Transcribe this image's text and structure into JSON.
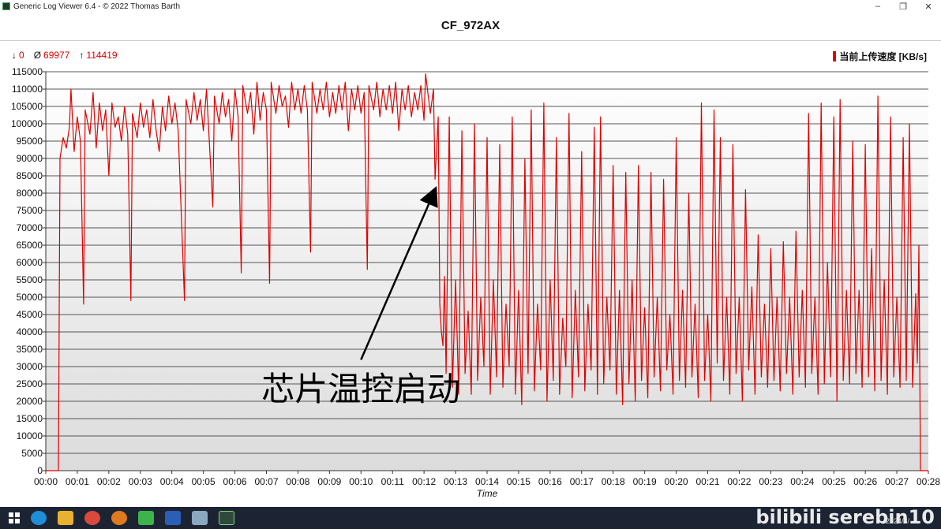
{
  "window": {
    "title": "Generic Log Viewer 6.4 - © 2022 Thomas Barth",
    "minimize_glyph": "–",
    "maximize_glyph": "❐",
    "close_glyph": "✕"
  },
  "stats": {
    "min_symbol": "↓",
    "min": "0",
    "avg_symbol": "Ø",
    "avg": "69977",
    "max_symbol": "↑",
    "max": "114419"
  },
  "taskbar": {
    "icons": [
      "windows-start-icon",
      "edge-icon",
      "file-explorer-icon",
      "chrome-icon",
      "search-app-icon",
      "wechat-icon",
      "word-icon",
      "app-icon",
      "terminal-icon"
    ],
    "watermark": "bilibili serebin10",
    "date": "2024/8/"
  },
  "chart_data": {
    "type": "line",
    "title": "CF_972AX",
    "xlabel": "Time",
    "ylabel": "",
    "ylim": [
      0,
      115000
    ],
    "yticks": [
      0,
      5000,
      10000,
      15000,
      20000,
      25000,
      30000,
      35000,
      40000,
      45000,
      50000,
      55000,
      60000,
      65000,
      70000,
      75000,
      80000,
      85000,
      90000,
      95000,
      100000,
      105000,
      110000,
      115000
    ],
    "xlim": [
      0,
      28
    ],
    "xticks": [
      "00:00",
      "00:01",
      "00:02",
      "00:03",
      "00:04",
      "00:05",
      "00:06",
      "00:07",
      "00:08",
      "00:09",
      "00:10",
      "00:11",
      "00:12",
      "00:13",
      "00:14",
      "00:15",
      "00:16",
      "00:17",
      "00:18",
      "00:19",
      "00:20",
      "00:21",
      "00:22",
      "00:23",
      "00:24",
      "00:25",
      "00:26",
      "00:27",
      "00:28"
    ],
    "grid": true,
    "legend_position": "top-right",
    "series": [
      {
        "name": "当前上传速度 [KB/s]",
        "color": "#e00000",
        "points": [
          [
            0,
            0
          ],
          [
            0.4,
            0
          ],
          [
            0.45,
            90000
          ],
          [
            0.55,
            96000
          ],
          [
            0.65,
            93000
          ],
          [
            0.75,
            99000
          ],
          [
            0.8,
            110000
          ],
          [
            0.9,
            92000
          ],
          [
            1.0,
            102000
          ],
          [
            1.1,
            95000
          ],
          [
            1.2,
            48000
          ],
          [
            1.25,
            104000
          ],
          [
            1.4,
            97000
          ],
          [
            1.5,
            109000
          ],
          [
            1.6,
            93000
          ],
          [
            1.7,
            106000
          ],
          [
            1.8,
            98000
          ],
          [
            1.9,
            104000
          ],
          [
            2.0,
            85000
          ],
          [
            2.1,
            106000
          ],
          [
            2.2,
            99000
          ],
          [
            2.3,
            102000
          ],
          [
            2.4,
            95000
          ],
          [
            2.5,
            105000
          ],
          [
            2.6,
            97000
          ],
          [
            2.7,
            49000
          ],
          [
            2.75,
            103000
          ],
          [
            2.9,
            96000
          ],
          [
            3.0,
            106000
          ],
          [
            3.1,
            99000
          ],
          [
            3.2,
            104000
          ],
          [
            3.3,
            96000
          ],
          [
            3.4,
            107000
          ],
          [
            3.5,
            98000
          ],
          [
            3.6,
            92000
          ],
          [
            3.7,
            105000
          ],
          [
            3.8,
            98000
          ],
          [
            3.9,
            108000
          ],
          [
            4.0,
            100000
          ],
          [
            4.1,
            106000
          ],
          [
            4.2,
            98000
          ],
          [
            4.4,
            49000
          ],
          [
            4.45,
            107000
          ],
          [
            4.6,
            100000
          ],
          [
            4.7,
            109000
          ],
          [
            4.8,
            101000
          ],
          [
            4.9,
            107000
          ],
          [
            5.0,
            98000
          ],
          [
            5.1,
            110000
          ],
          [
            5.3,
            76000
          ],
          [
            5.35,
            108000
          ],
          [
            5.5,
            100000
          ],
          [
            5.6,
            109000
          ],
          [
            5.7,
            102000
          ],
          [
            5.8,
            107000
          ],
          [
            5.9,
            95000
          ],
          [
            6.0,
            110000
          ],
          [
            6.1,
            102000
          ],
          [
            6.2,
            57000
          ],
          [
            6.25,
            111000
          ],
          [
            6.4,
            103000
          ],
          [
            6.5,
            109000
          ],
          [
            6.6,
            97000
          ],
          [
            6.7,
            112000
          ],
          [
            6.8,
            101000
          ],
          [
            6.9,
            109000
          ],
          [
            7.0,
            104000
          ],
          [
            7.1,
            54000
          ],
          [
            7.15,
            112000
          ],
          [
            7.3,
            103000
          ],
          [
            7.4,
            111000
          ],
          [
            7.5,
            105000
          ],
          [
            7.6,
            108000
          ],
          [
            7.7,
            99000
          ],
          [
            7.8,
            112000
          ],
          [
            7.9,
            104000
          ],
          [
            8.0,
            110000
          ],
          [
            8.1,
            103000
          ],
          [
            8.2,
            111000
          ],
          [
            8.3,
            104000
          ],
          [
            8.4,
            63000
          ],
          [
            8.45,
            112000
          ],
          [
            8.6,
            103000
          ],
          [
            8.7,
            110000
          ],
          [
            8.8,
            104000
          ],
          [
            8.9,
            112000
          ],
          [
            9.0,
            102000
          ],
          [
            9.1,
            109000
          ],
          [
            9.2,
            103000
          ],
          [
            9.3,
            111000
          ],
          [
            9.4,
            104000
          ],
          [
            9.5,
            112000
          ],
          [
            9.6,
            98000
          ],
          [
            9.7,
            110000
          ],
          [
            9.8,
            104000
          ],
          [
            9.9,
            111000
          ],
          [
            10.0,
            103000
          ],
          [
            10.1,
            109000
          ],
          [
            10.2,
            58000
          ],
          [
            10.25,
            111000
          ],
          [
            10.4,
            104000
          ],
          [
            10.5,
            112000
          ],
          [
            10.6,
            102000
          ],
          [
            10.7,
            110000
          ],
          [
            10.8,
            104000
          ],
          [
            10.9,
            111000
          ],
          [
            11.0,
            103000
          ],
          [
            11.1,
            112000
          ],
          [
            11.2,
            98000
          ],
          [
            11.3,
            110000
          ],
          [
            11.4,
            104000
          ],
          [
            11.5,
            111000
          ],
          [
            11.6,
            102000
          ],
          [
            11.7,
            109000
          ],
          [
            11.8,
            104000
          ],
          [
            11.9,
            111000
          ],
          [
            12.0,
            101000
          ],
          [
            12.05,
            114419
          ],
          [
            12.2,
            103000
          ],
          [
            12.3,
            110000
          ],
          [
            12.35,
            84000
          ],
          [
            12.45,
            102000
          ],
          [
            12.5,
            48000
          ],
          [
            12.55,
            40000
          ],
          [
            12.6,
            36000
          ],
          [
            12.65,
            56000
          ],
          [
            12.7,
            28000
          ],
          [
            12.8,
            102000
          ],
          [
            12.9,
            24000
          ],
          [
            13.0,
            55000
          ],
          [
            13.1,
            22000
          ],
          [
            13.2,
            98000
          ],
          [
            13.3,
            28000
          ],
          [
            13.4,
            46000
          ],
          [
            13.5,
            22000
          ],
          [
            13.6,
            100000
          ],
          [
            13.7,
            26000
          ],
          [
            13.8,
            50000
          ],
          [
            13.9,
            30000
          ],
          [
            14.0,
            96000
          ],
          [
            14.1,
            22000
          ],
          [
            14.2,
            55000
          ],
          [
            14.3,
            27000
          ],
          [
            14.4,
            94000
          ],
          [
            14.5,
            24000
          ],
          [
            14.6,
            48000
          ],
          [
            14.7,
            30000
          ],
          [
            14.8,
            102000
          ],
          [
            14.9,
            22000
          ],
          [
            15.0,
            52000
          ],
          [
            15.1,
            19000
          ],
          [
            15.2,
            90000
          ],
          [
            15.3,
            28000
          ],
          [
            15.4,
            104000
          ],
          [
            15.5,
            23000
          ],
          [
            15.6,
            48000
          ],
          [
            15.7,
            29000
          ],
          [
            15.8,
            106000
          ],
          [
            15.9,
            20000
          ],
          [
            16.0,
            55000
          ],
          [
            16.1,
            26000
          ],
          [
            16.2,
            96000
          ],
          [
            16.3,
            22000
          ],
          [
            16.4,
            44000
          ],
          [
            16.5,
            30000
          ],
          [
            16.6,
            103000
          ],
          [
            16.7,
            21000
          ],
          [
            16.8,
            52000
          ],
          [
            16.9,
            27000
          ],
          [
            17.0,
            92000
          ],
          [
            17.1,
            23000
          ],
          [
            17.2,
            48000
          ],
          [
            17.3,
            29000
          ],
          [
            17.4,
            99000
          ],
          [
            17.5,
            22000
          ],
          [
            17.6,
            102000
          ],
          [
            17.7,
            25000
          ],
          [
            17.8,
            50000
          ],
          [
            17.9,
            29000
          ],
          [
            18.0,
            88000
          ],
          [
            18.1,
            22000
          ],
          [
            18.2,
            52000
          ],
          [
            18.3,
            19000
          ],
          [
            18.4,
            86000
          ],
          [
            18.5,
            25000
          ],
          [
            18.6,
            55000
          ],
          [
            18.7,
            20000
          ],
          [
            18.8,
            88000
          ],
          [
            18.9,
            26000
          ],
          [
            19.0,
            47000
          ],
          [
            19.1,
            21000
          ],
          [
            19.2,
            86000
          ],
          [
            19.3,
            27000
          ],
          [
            19.4,
            50000
          ],
          [
            19.5,
            23000
          ],
          [
            19.6,
            84000
          ],
          [
            19.7,
            29000
          ],
          [
            19.8,
            45000
          ],
          [
            19.9,
            22000
          ],
          [
            20.0,
            96000
          ],
          [
            20.1,
            26000
          ],
          [
            20.2,
            52000
          ],
          [
            20.3,
            24000
          ],
          [
            20.4,
            80000
          ],
          [
            20.5,
            27000
          ],
          [
            20.6,
            48000
          ],
          [
            20.7,
            21000
          ],
          [
            20.8,
            106000
          ],
          [
            20.9,
            26000
          ],
          [
            21.0,
            45000
          ],
          [
            21.1,
            20000
          ],
          [
            21.2,
            104000
          ],
          [
            21.3,
            31000
          ],
          [
            21.4,
            96000
          ],
          [
            21.5,
            26000
          ],
          [
            21.6,
            50000
          ],
          [
            21.7,
            22000
          ],
          [
            21.8,
            94000
          ],
          [
            21.9,
            28000
          ],
          [
            22.0,
            50000
          ],
          [
            22.1,
            20000
          ],
          [
            22.2,
            81000
          ],
          [
            22.3,
            29000
          ],
          [
            22.4,
            53000
          ],
          [
            22.5,
            22000
          ],
          [
            22.6,
            68000
          ],
          [
            22.7,
            27000
          ],
          [
            22.8,
            48000
          ],
          [
            22.9,
            24000
          ],
          [
            23.0,
            64000
          ],
          [
            23.1,
            26000
          ],
          [
            23.2,
            50000
          ],
          [
            23.3,
            23000
          ],
          [
            23.4,
            66000
          ],
          [
            23.5,
            28000
          ],
          [
            23.6,
            50000
          ],
          [
            23.7,
            22000
          ],
          [
            23.8,
            69000
          ],
          [
            23.9,
            27000
          ],
          [
            24.0,
            52000
          ],
          [
            24.1,
            24000
          ],
          [
            24.2,
            103000
          ],
          [
            24.3,
            28000
          ],
          [
            24.4,
            50000
          ],
          [
            24.5,
            22000
          ],
          [
            24.6,
            106000
          ],
          [
            24.7,
            25000
          ],
          [
            24.8,
            60000
          ],
          [
            24.9,
            27000
          ],
          [
            25.0,
            102000
          ],
          [
            25.1,
            20000
          ],
          [
            25.2,
            107000
          ],
          [
            25.3,
            26000
          ],
          [
            25.4,
            52000
          ],
          [
            25.5,
            25000
          ],
          [
            25.6,
            95000
          ],
          [
            25.7,
            28000
          ],
          [
            25.8,
            52000
          ],
          [
            25.9,
            24000
          ],
          [
            26.0,
            94000
          ],
          [
            26.1,
            27000
          ],
          [
            26.2,
            64000
          ],
          [
            26.3,
            23000
          ],
          [
            26.4,
            108000
          ],
          [
            26.5,
            26000
          ],
          [
            26.6,
            55000
          ],
          [
            26.7,
            22000
          ],
          [
            26.8,
            102000
          ],
          [
            26.9,
            27000
          ],
          [
            27.0,
            50000
          ],
          [
            27.1,
            24000
          ],
          [
            27.2,
            96000
          ],
          [
            27.3,
            26000
          ],
          [
            27.4,
            100000
          ],
          [
            27.5,
            24000
          ],
          [
            27.6,
            51000
          ],
          [
            27.65,
            31000
          ],
          [
            27.7,
            65000
          ],
          [
            27.75,
            0
          ],
          [
            28.0,
            0
          ]
        ]
      }
    ],
    "annotation": {
      "text": "芯片温控启动",
      "target_x": 12.35,
      "target_y": 81000,
      "tail_x": 10.0,
      "tail_y": 32000
    }
  }
}
